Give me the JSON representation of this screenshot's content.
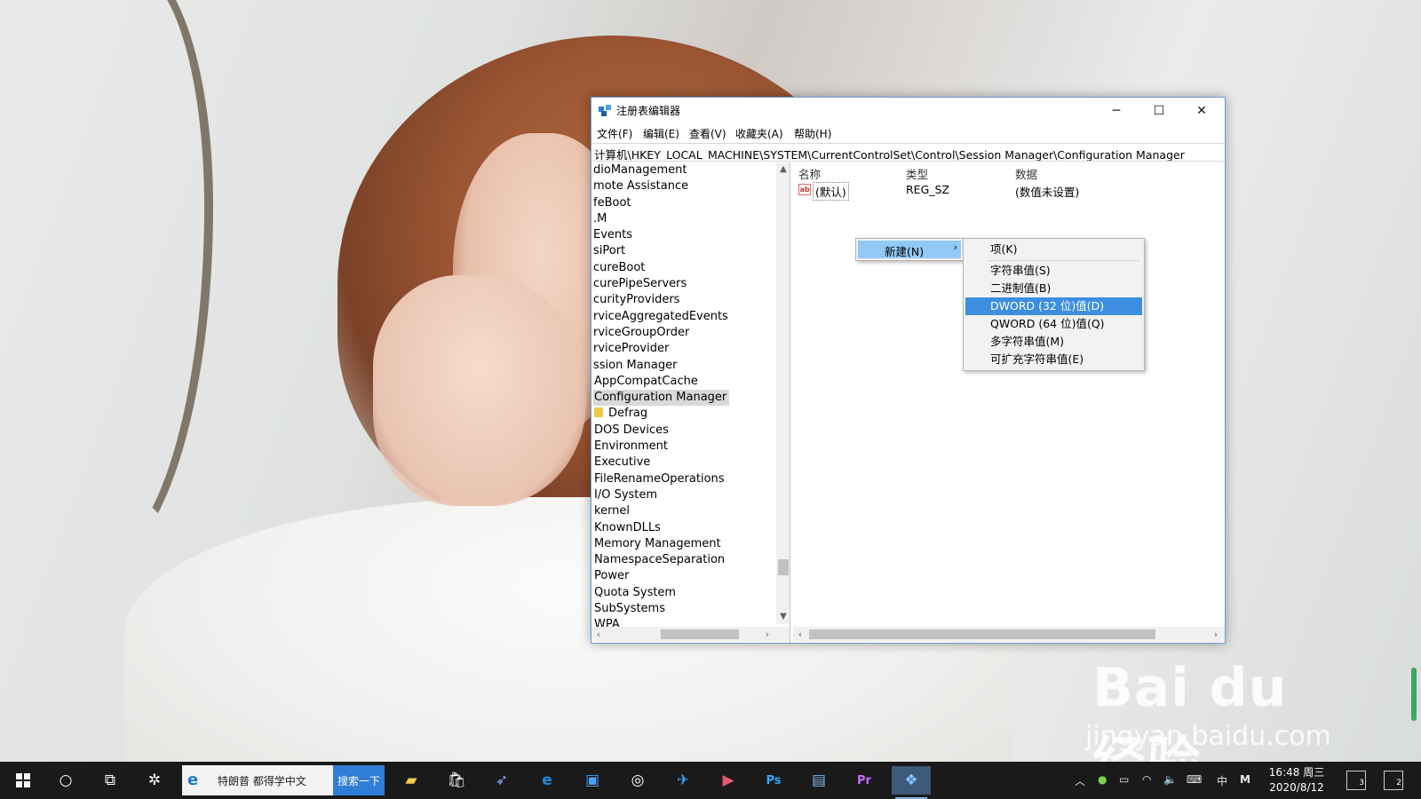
{
  "window": {
    "title": "注册表编辑器",
    "controls": {
      "minimize": "─",
      "maximize": "☐",
      "close": "✕"
    },
    "menu": [
      "文件(F)",
      "编辑(E)",
      "查看(V)",
      "收藏夹(A)",
      "帮助(H)"
    ],
    "address": "计算机\\HKEY_LOCAL_MACHINE\\SYSTEM\\CurrentControlSet\\Control\\Session Manager\\Configuration Manager"
  },
  "tree": {
    "items": [
      {
        "label": "dioManagement"
      },
      {
        "label": "mote Assistance"
      },
      {
        "label": "feBoot"
      },
      {
        "label": ".M"
      },
      {
        "label": "Events"
      },
      {
        "label": "siPort"
      },
      {
        "label": "cureBoot"
      },
      {
        "label": "curePipeServers"
      },
      {
        "label": "curityProviders"
      },
      {
        "label": "rviceAggregatedEvents"
      },
      {
        "label": "rviceGroupOrder"
      },
      {
        "label": "rviceProvider"
      },
      {
        "label": "ssion Manager"
      },
      {
        "label": "AppCompatCache"
      },
      {
        "label": "Configuration Manager",
        "selected": true
      },
      {
        "label": "Defrag",
        "folder": true
      },
      {
        "label": "DOS Devices"
      },
      {
        "label": "Environment"
      },
      {
        "label": "Executive"
      },
      {
        "label": "FileRenameOperations"
      },
      {
        "label": "I/O System"
      },
      {
        "label": "kernel"
      },
      {
        "label": "KnownDLLs"
      },
      {
        "label": "Memory Management"
      },
      {
        "label": "NamespaceSeparation"
      },
      {
        "label": "Power"
      },
      {
        "label": "Quota System"
      },
      {
        "label": "SubSystems"
      },
      {
        "label": "WPA"
      }
    ],
    "scroll_position": 0.86
  },
  "values": {
    "columns": [
      "名称",
      "类型",
      "数据"
    ],
    "rows": [
      {
        "icon": "ab",
        "name": "(默认)",
        "type": "REG_SZ",
        "data": "(数值未设置)"
      }
    ]
  },
  "context_menu": {
    "new": "新建(N)",
    "arrow": "›",
    "submenu": [
      "项(K)",
      "字符串值(S)",
      "二进制值(B)",
      "DWORD (32 位)值(D)",
      "QWORD (64 位)值(Q)",
      "多字符串值(M)",
      "可扩充字符串值(E)"
    ],
    "highlighted_index": 3
  },
  "taskbar": {
    "search_text": "特朗普 都得学中文",
    "search_button": "搜索一下",
    "tray": {
      "ime_lang": "中",
      "ime_mode": "M",
      "time": "16:48 周三",
      "date": "2020/8/12",
      "notification_count": "3",
      "action_count": "2"
    }
  },
  "watermark": {
    "logo": "Bai du 经验",
    "url": "jingyan.baidu.com"
  },
  "colors": {
    "menu_highlight": "#3d8ee0",
    "submenu_parent_highlight": "#91c9f7",
    "taskbar": "#1a1a1a",
    "window_border": "#6b9bd1"
  }
}
